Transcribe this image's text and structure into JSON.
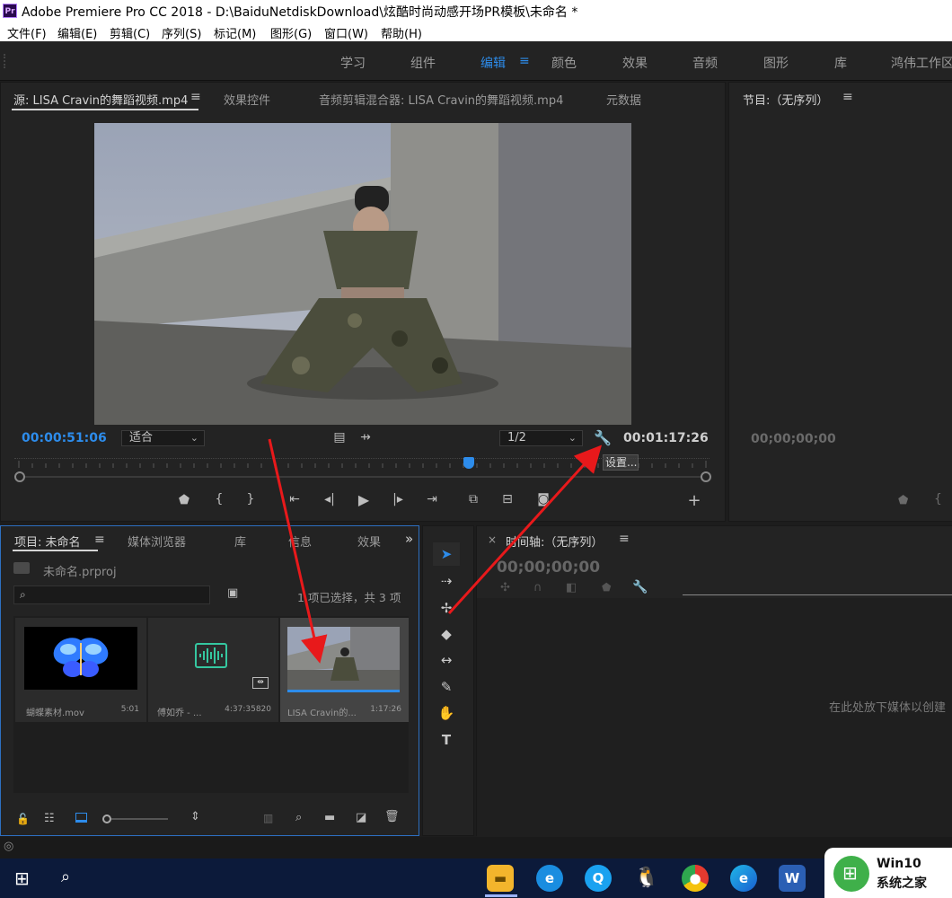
{
  "window": {
    "title": "Adobe Premiere Pro CC 2018 - D:\\BaiduNetdiskDownload\\炫酷时尚动感开场PR模板\\未命名 *",
    "app_icon": "Pr"
  },
  "menu": [
    "文件(F)",
    "编辑(E)",
    "剪辑(C)",
    "序列(S)",
    "标记(M)",
    "图形(G)",
    "窗口(W)",
    "帮助(H)"
  ],
  "workspaces": {
    "items": [
      "学习",
      "组件",
      "编辑",
      "颜色",
      "效果",
      "音频",
      "图形",
      "库",
      "鸿伟工作区"
    ],
    "active": "编辑"
  },
  "source_panel": {
    "tabs": [
      "源: LISA Cravin的舞蹈视频.mp4",
      "效果控件",
      "音频剪辑混合器: LISA Cravin的舞蹈视频.mp4",
      "元数据"
    ],
    "current_timecode": "00:00:51:06",
    "fit_label": "适合",
    "resolution": "1/2",
    "duration": "00:01:17:26",
    "tooltip": "设置..."
  },
  "program_panel": {
    "title": "节目:（无序列）",
    "timecode": "00;00;00;00"
  },
  "project_panel": {
    "tabs": [
      "项目: 未命名",
      "媒体浏览器",
      "库",
      "信息",
      "效果"
    ],
    "project_file": "未命名.prproj",
    "search_placeholder": "",
    "selection_status": "1 项已选择，共 3 项",
    "items": [
      {
        "name": "蝴蝶素材.mov",
        "duration": "5:01"
      },
      {
        "name": "傅如乔 - ...",
        "duration": "4:37:35820"
      },
      {
        "name": "LISA Cravin的...",
        "duration": "1:17:26"
      }
    ]
  },
  "timeline_panel": {
    "title": "时间轴:（无序列）",
    "timecode": "00;00;00;00",
    "drop_hint": "在此处放下媒体以创建"
  },
  "taskbar": {
    "badge_line1": "Win10",
    "badge_line2": "系统之家"
  },
  "colors": {
    "accent_blue": "#2d8ceb",
    "panel_bg": "#232323",
    "arrow_red": "#e8191b"
  }
}
